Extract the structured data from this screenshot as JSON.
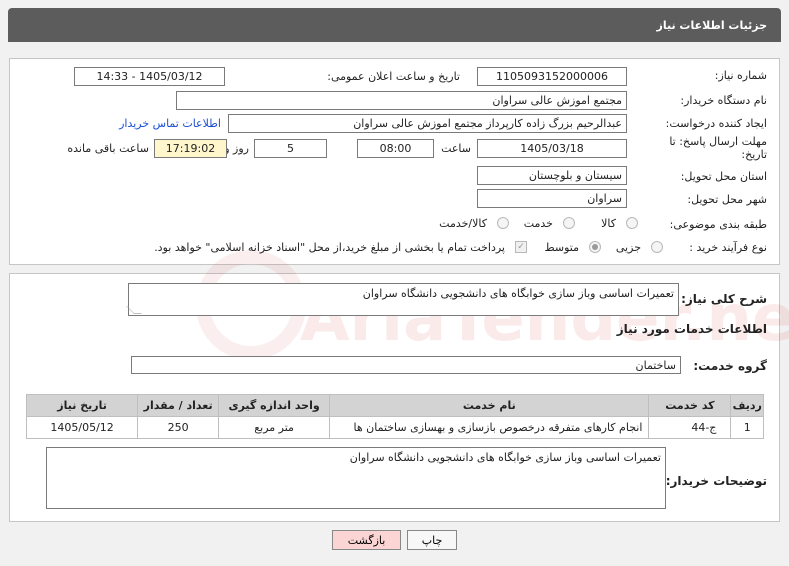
{
  "header": {
    "title": "جزئیات اطلاعات نیاز"
  },
  "form": {
    "need_number_label": "شماره نیاز:",
    "need_number": "1105093152000006",
    "announce_label": "تاریخ و ساعت اعلان عمومی:",
    "announce_value": "1405/03/12 - 14:33",
    "buyer_label": "نام دستگاه خریدار:",
    "buyer_value": "مجتمع اموزش عالی سراوان",
    "creator_label": "ایجاد کننده درخواست:",
    "creator_value": "عبدالرحیم بزرگ زاده کارپرداز مجتمع اموزش عالی سراوان",
    "contact_link": "اطلاعات تماس خریدار",
    "deadline_label": "مهلت ارسال پاسخ: تا تاریخ:",
    "deadline_date": "1405/03/18",
    "time_label": "ساعت",
    "deadline_time": "08:00",
    "days_value": "5",
    "days_label": "روز و",
    "remaining_value": "17:19:02",
    "remaining_label": "ساعت باقی مانده",
    "province_label": "استان محل تحویل:",
    "province_value": "سیستان و بلوچستان",
    "city_label": "شهر محل تحویل:",
    "city_value": "سراوان",
    "category_label": "طبقه بندی موضوعی:",
    "category_options": [
      "کالا",
      "خدمت",
      "کالا/خدمت"
    ],
    "process_label": "نوع فرآیند خرید :",
    "process_options": [
      "جزیی",
      "متوسط"
    ],
    "payment_note": "پرداخت تمام یا بخشی از مبلغ خرید،از محل \"اسناد خزانه اسلامی\" خواهد بود."
  },
  "description": {
    "label": "شرح کلی نیاز:",
    "value": "تعمیرات اساسی وباز سازی خوابگاه های دانشجویی دانشگاه سراوان"
  },
  "services": {
    "section_title": "اطلاعات خدمات مورد نیاز",
    "group_label": "گروه خدمت:",
    "group_value": "ساختمان",
    "columns": [
      "ردیف",
      "کد خدمت",
      "نام خدمت",
      "واحد اندازه گیری",
      "تعداد / مقدار",
      "تاریخ نیاز"
    ],
    "rows": [
      {
        "row": "1",
        "code": "ج-44",
        "name": "انجام کارهای متفرقه درخصوص بازسازی و بهسازی ساختمان ها",
        "unit": "متر مربع",
        "qty": "250",
        "date": "1405/05/12"
      }
    ]
  },
  "buyer_notes": {
    "label": "توضیحات خریدار:",
    "value": "تعمیرات اساسی وباز سازی خوابگاه های دانشجویی دانشگاه سراوان"
  },
  "buttons": {
    "print": "چاپ",
    "back": "بازگشت"
  },
  "watermark": {
    "text": "AriaTender.net"
  },
  "colors": {
    "header": "#5c5c5c",
    "link": "#1a4fd6",
    "back_button": "#fbd4d4",
    "highlight": "#fff6cc"
  }
}
